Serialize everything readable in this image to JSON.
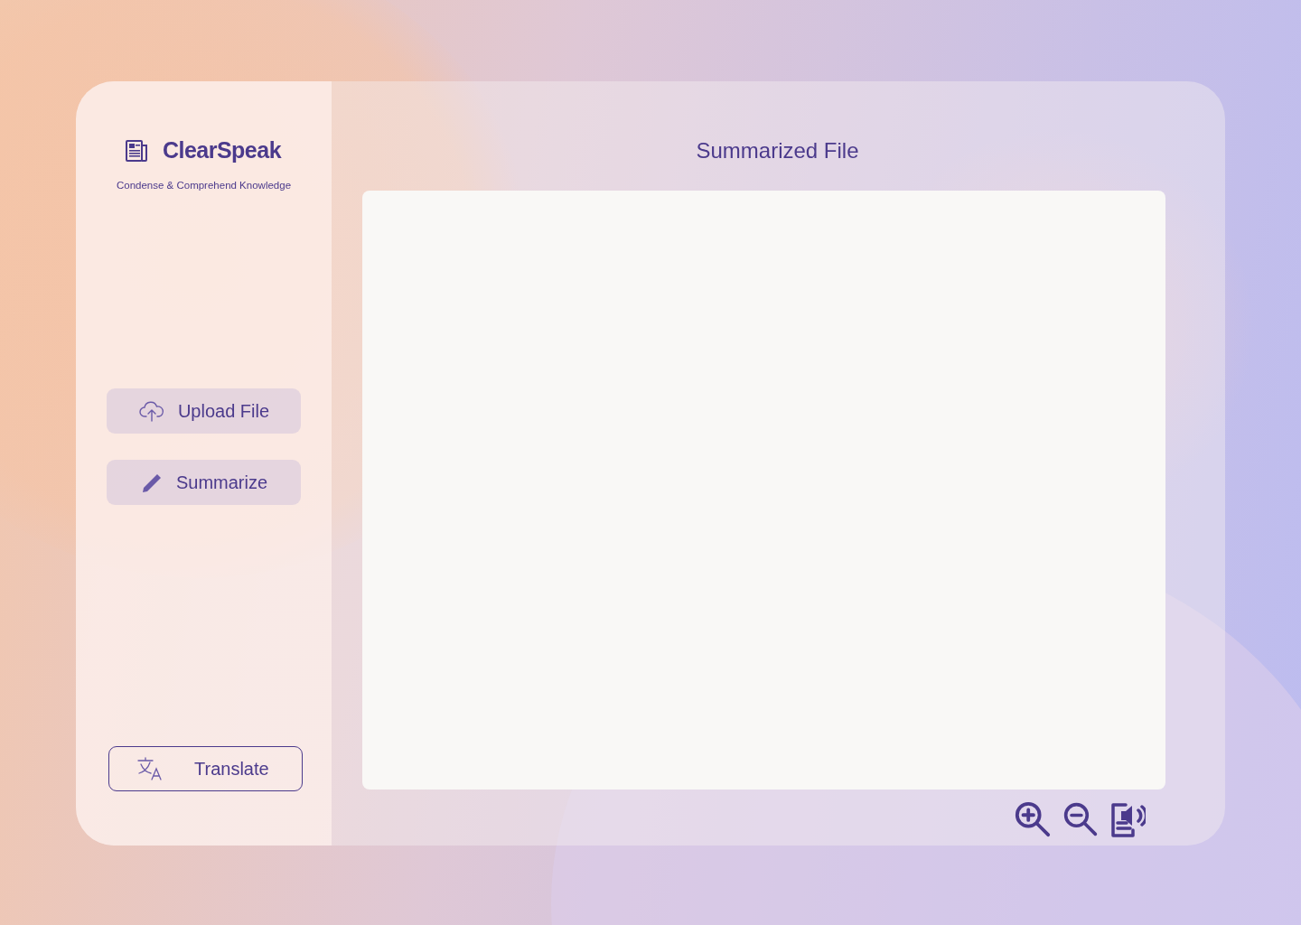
{
  "app": {
    "name": "ClearSpeak",
    "tagline": "Condense & Comprehend Knowledge"
  },
  "sidebar": {
    "buttons": [
      {
        "kind": "upload",
        "label": "Upload File"
      },
      {
        "kind": "summarize",
        "label": "Summarize"
      }
    ],
    "translate_button": {
      "label": "Translate"
    }
  },
  "main": {
    "title": "Summarized File"
  }
}
